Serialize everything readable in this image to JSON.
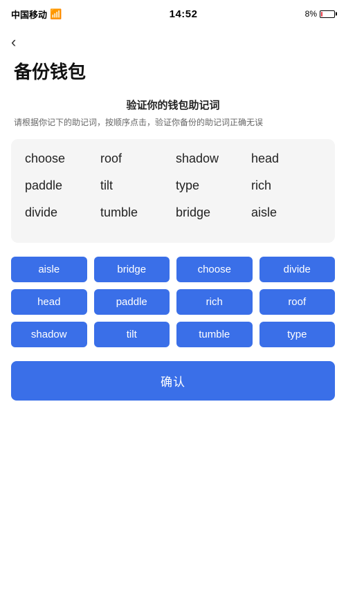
{
  "statusBar": {
    "carrier": "中国移动",
    "time": "14:52",
    "batteryPercent": "8%"
  },
  "backButton": "‹",
  "pageTitle": "备份钱包",
  "sectionHeading": "验证你的钱包助记词",
  "sectionDesc": "请根据你记下的助记词，按顺序点击，验证你备份的助记词正确无误",
  "displayWords": [
    "choose",
    "roof",
    "shadow",
    "head",
    "paddle",
    "tilt",
    "type",
    "rich",
    "divide",
    "tumble",
    "bridge",
    "aisle"
  ],
  "wordChips": [
    "aisle",
    "bridge",
    "choose",
    "divide",
    "head",
    "paddle",
    "rich",
    "roof",
    "shadow",
    "tilt",
    "tumble",
    "type"
  ],
  "confirmButton": "确认"
}
